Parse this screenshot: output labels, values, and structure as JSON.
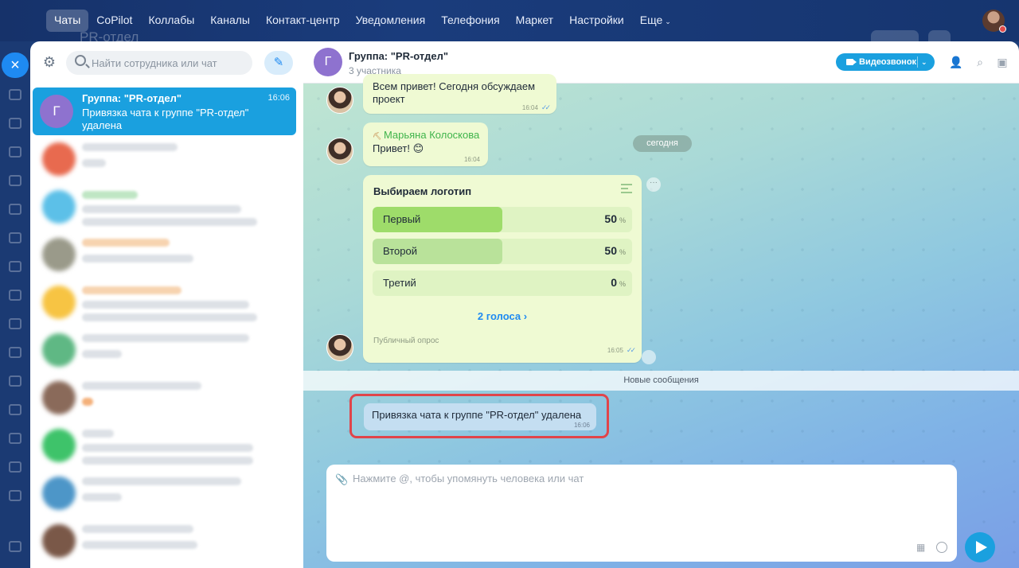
{
  "nav": {
    "items": [
      {
        "label": "Чаты",
        "active": true
      },
      {
        "label": "CoPilot"
      },
      {
        "label": "Коллабы"
      },
      {
        "label": "Каналы"
      },
      {
        "label": "Контакт-центр"
      },
      {
        "label": "Уведомления"
      },
      {
        "label": "Телефония"
      },
      {
        "label": "Маркет"
      },
      {
        "label": "Настройки"
      },
      {
        "label": "Еще"
      }
    ],
    "ghost_title": "PR-отдел"
  },
  "sidebar": {
    "search_placeholder": "Найти сотрудника или чат",
    "active_chat": {
      "avatar_letter": "Г",
      "name": "Группа: \"PR-отдел\"",
      "time": "16:06",
      "last_message": "Привязка чата к группе \"PR-отдел\" удалена"
    }
  },
  "header": {
    "avatar_letter": "Г",
    "title": "Группа: \"PR-отдел\"",
    "subtitle": "3 участника",
    "video_button": "Видеозвонок"
  },
  "messages": {
    "m1_text": "Всем привет! Сегодня обсуждаем проект",
    "m1_time": "16:04",
    "day_badge": "сегодня",
    "m2_sender": "Марьяна Колоскова",
    "m2_text": "Привет! 😊",
    "m2_time": "16:04",
    "poll": {
      "title": "Выбираем логотип",
      "options": [
        {
          "label": "Первый",
          "percent": 50
        },
        {
          "label": "Второй",
          "percent": 50
        },
        {
          "label": "Третий",
          "percent": 0
        }
      ],
      "percent_sign": "%",
      "votes": "2 голоса",
      "visibility": "Публичный опрос",
      "time": "16:05"
    },
    "new_messages_divider": "Новые сообщения",
    "system_text": "Привязка чата к группе \"PR-отдел\" удалена",
    "system_time": "16:06"
  },
  "composer": {
    "placeholder": "Нажмите @, чтобы упомянуть человека или чат"
  },
  "colors": {
    "accent": "#1aa0df",
    "nav_bg": "#1a3c7c",
    "bubble": "#effad3",
    "highlight": "#e0454a"
  }
}
